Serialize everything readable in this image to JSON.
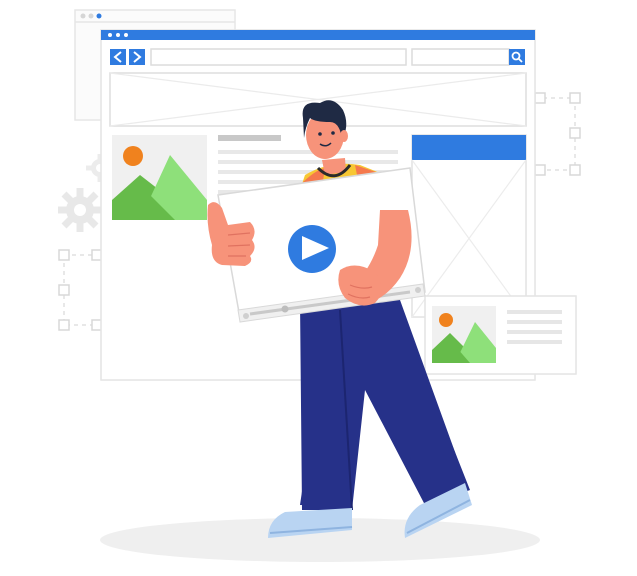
{
  "colors": {
    "accent_blue": "#2f7be0",
    "wire_gray": "#d9d9d9",
    "panel_gray": "#f2f2f2",
    "mountain_green": "#66bb4a",
    "mountain_light": "#8ee07a",
    "sun_orange": "#f0821e",
    "shirt_orange": "#f5794d",
    "shirt_yellow": "#f7c733",
    "pants_navy": "#263189",
    "shoe_light": "#b9d4f2",
    "skin": "#f7937a",
    "hair_dark": "#1f2a44"
  },
  "icons": [
    "chevron-left-icon",
    "chevron-right-icon",
    "search-icon",
    "play-icon",
    "gear-icon",
    "image-icon"
  ]
}
